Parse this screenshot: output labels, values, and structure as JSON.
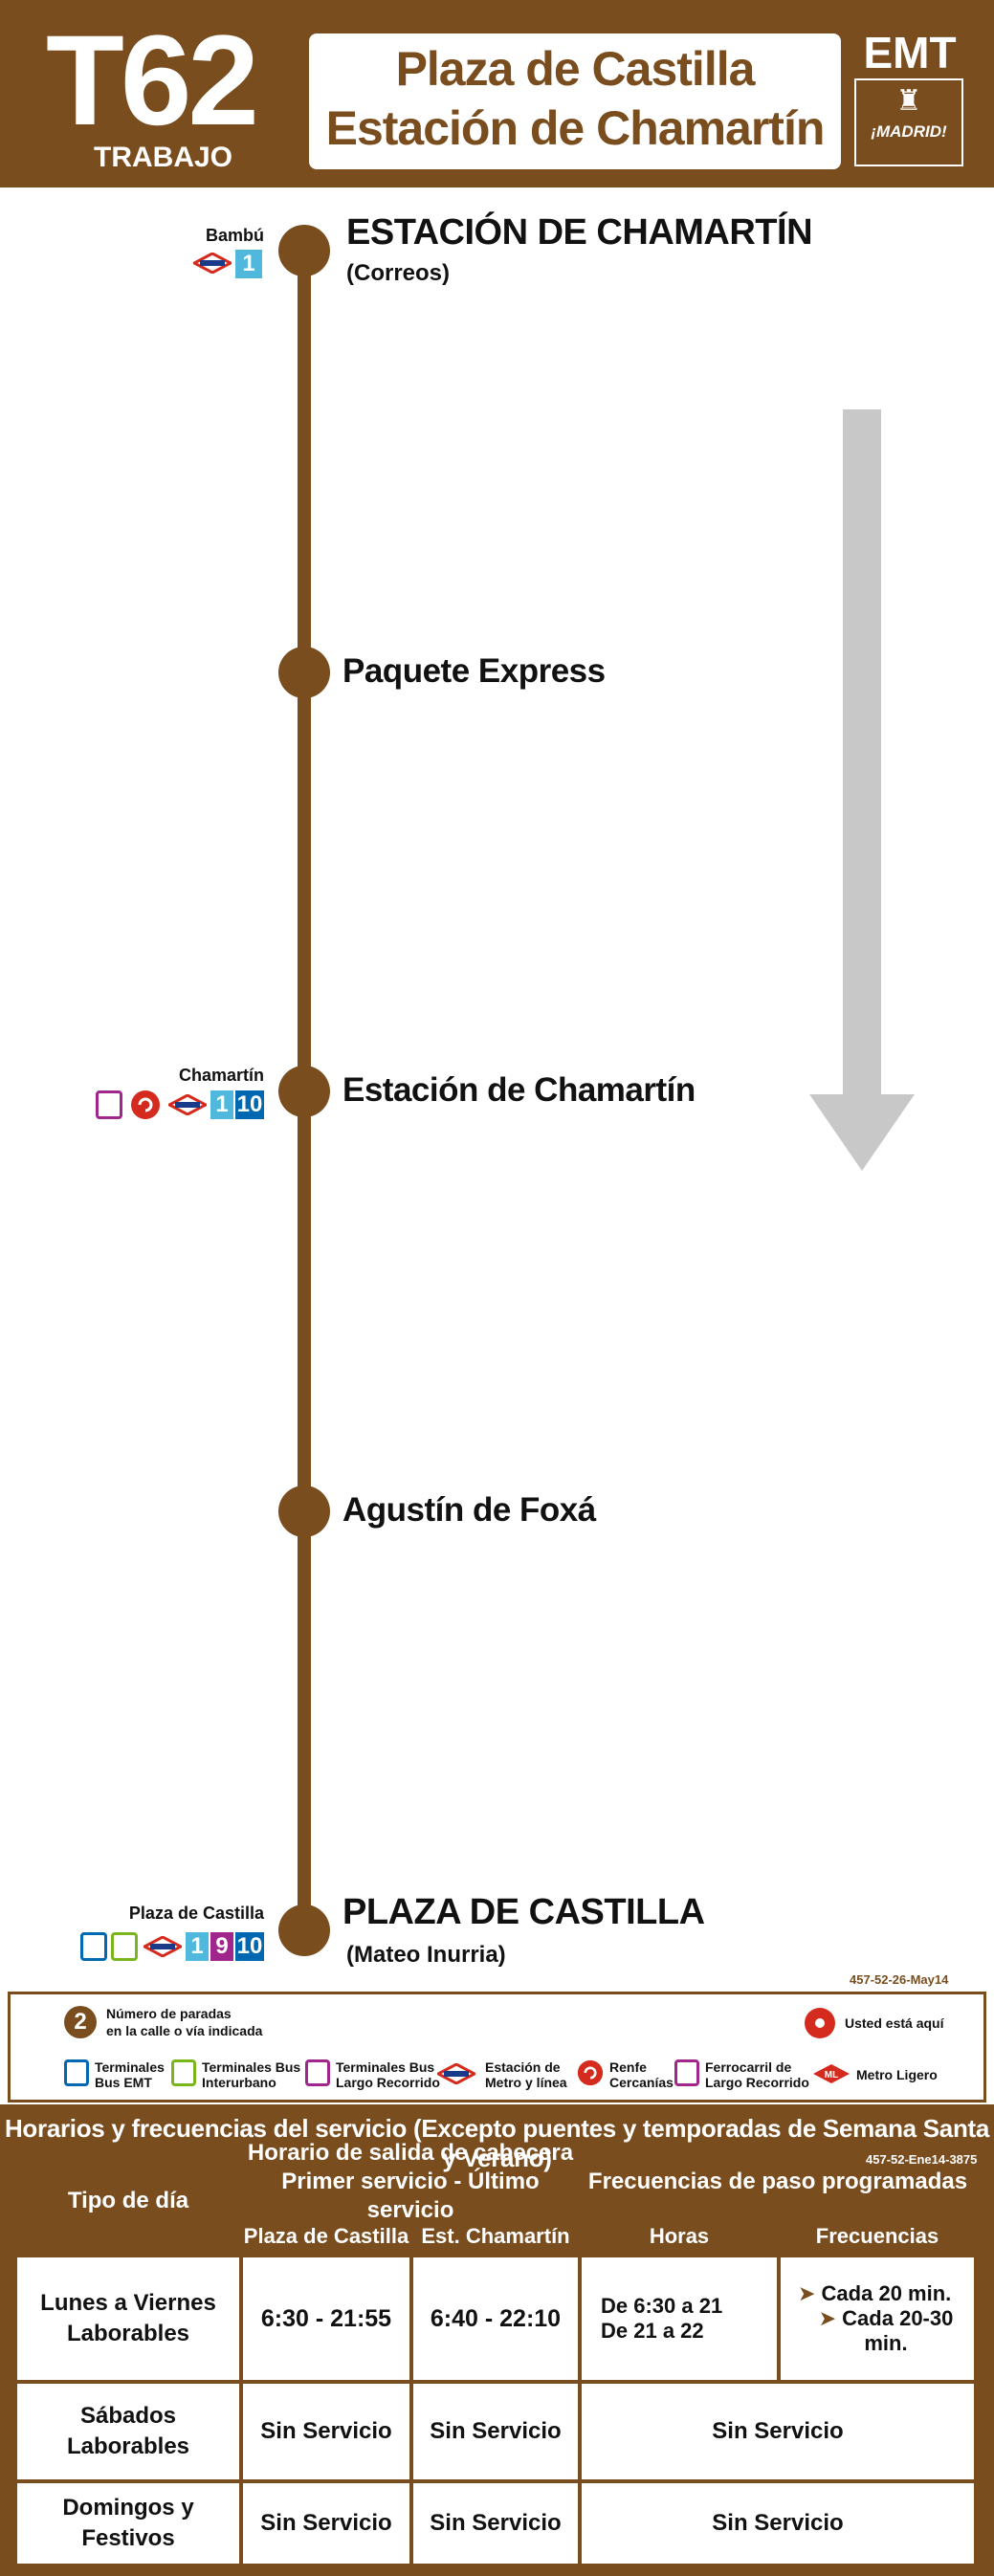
{
  "header": {
    "line_number": "T62",
    "line_type": "TRABAJO",
    "destination_1": "Plaza de Castilla",
    "destination_2": "Estación de Chamartín",
    "operator": "EMT",
    "city_logo": "¡MADRID!"
  },
  "stops": [
    {
      "name": "ESTACIÓN DE CHAMARTÍN",
      "sub": "(Correos)",
      "connection_name": "Bambú",
      "lines": [
        "1"
      ]
    },
    {
      "name": "Paquete Express"
    },
    {
      "name": "Estación de Chamartín",
      "connection_name": "Chamartín",
      "lines": [
        "1",
        "10"
      ]
    },
    {
      "name": "Agustín de Foxá"
    },
    {
      "name": "PLAZA DE CASTILLA",
      "sub": "(Mateo Inurria)",
      "connection_name": "Plaza de Castilla",
      "lines": [
        "1",
        "9",
        "10"
      ]
    }
  ],
  "code_1": "457-52-26-May14",
  "legend": {
    "stops_number": "2",
    "stops_text_1": "Número de paradas",
    "stops_text_2": "en la calle o vía indicada",
    "you_are_here": "Usted está aquí",
    "items": [
      {
        "l1": "Terminales",
        "l2": "Bus EMT"
      },
      {
        "l1": "Terminales Bus",
        "l2": "Interurbano"
      },
      {
        "l1": "Terminales Bus",
        "l2": "Largo Recorrido"
      },
      {
        "l1": "Estación de",
        "l2": "Metro y línea"
      },
      {
        "l1": "Renfe",
        "l2": "Cercanías"
      },
      {
        "l1": "Ferrocarril de",
        "l2": "Largo Recorrido"
      },
      {
        "l1": "Metro Ligero",
        "l2": ""
      }
    ]
  },
  "schedule": {
    "title": "Horarios y frecuencias del servicio (Excepto puentes y temporadas de Semana Santa y Verano)",
    "code": "457-52-Ene14-3875",
    "col_day_type": "Tipo de día",
    "col_departure_1": "Horario de salida de cabecera",
    "col_departure_2": "Primer servicio - Último servicio",
    "col_freq_title": "Frecuencias de paso programadas",
    "sub_plaza": "Plaza de Castilla",
    "sub_chamartin": "Est. Chamartín",
    "sub_hours": "Horas",
    "sub_freqs": "Frecuencias",
    "rows": [
      {
        "day_1": "Lunes a Viernes",
        "day_2": "Laborables",
        "plaza": "6:30 - 21:55",
        "chamartin": "6:40 - 22:10",
        "hours_1": "De 6:30 a 21",
        "hours_2": "De 21 a 22",
        "freq_1": "Cada 20 min.",
        "freq_2": "Cada 20-30 min."
      },
      {
        "day_1": "Sábados",
        "day_2": "Laborables",
        "plaza": "Sin Servicio",
        "chamartin": "Sin Servicio",
        "freq": "Sin Servicio"
      },
      {
        "day_1": "Domingos y",
        "day_2": "Festivos",
        "plaza": "Sin Servicio",
        "chamartin": "Sin Servicio",
        "freq": "Sin Servicio"
      }
    ]
  }
}
